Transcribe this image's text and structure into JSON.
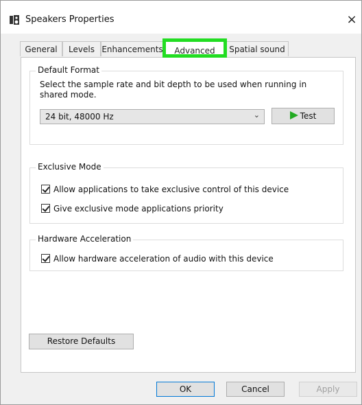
{
  "window": {
    "title": "Speakers Properties",
    "close_label": "×",
    "title_icon": "speaker-icon"
  },
  "tabs": [
    {
      "label": "General",
      "active": false
    },
    {
      "label": "Levels",
      "active": false
    },
    {
      "label": "Enhancements",
      "active": false
    },
    {
      "label": "Advanced",
      "active": true
    },
    {
      "label": "Spatial sound",
      "active": false
    }
  ],
  "default_format": {
    "title": "Default Format",
    "description": "Select the sample rate and bit depth to be used when running in shared mode.",
    "selected": "24 bit, 48000 Hz",
    "test_label": "Test"
  },
  "exclusive_mode": {
    "title": "Exclusive Mode",
    "options": [
      {
        "label": "Allow applications to take exclusive control of this device",
        "checked": true
      },
      {
        "label": "Give exclusive mode applications priority",
        "checked": true
      }
    ]
  },
  "hardware_acceleration": {
    "title": "Hardware Acceleration",
    "options": [
      {
        "label": "Allow hardware acceleration of audio with this device",
        "checked": true
      }
    ]
  },
  "restore_label": "Restore Defaults",
  "footer": {
    "ok_label": "OK",
    "cancel_label": "Cancel",
    "apply_label": "Apply"
  },
  "colors": {
    "highlight": "#22dd22",
    "play_icon": "#22aa22"
  }
}
